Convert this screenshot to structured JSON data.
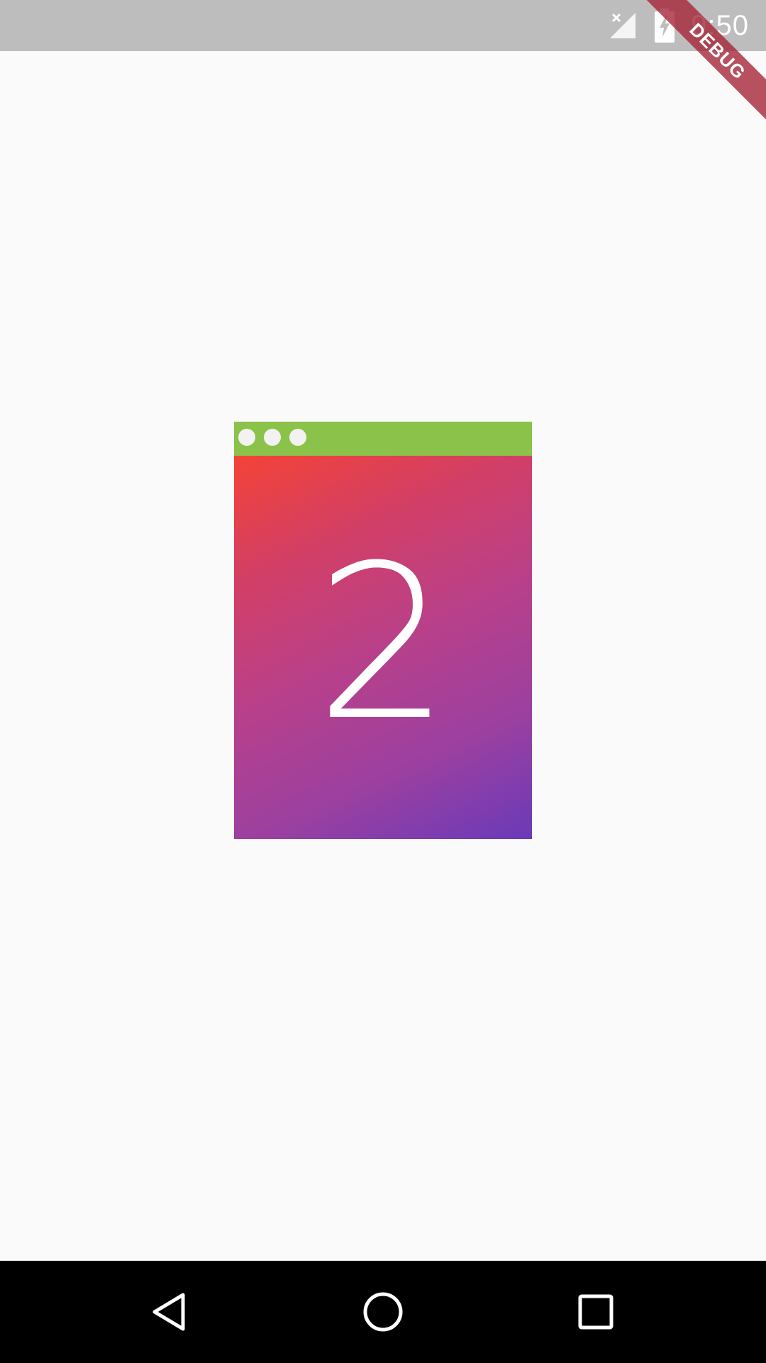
{
  "status_bar": {
    "time": "9:50",
    "icons": [
      "signal-off-icon",
      "battery-charging-icon"
    ],
    "background": "#bdbdbd"
  },
  "debug_banner": {
    "label": "DEBUG",
    "color": "#a42135"
  },
  "card": {
    "number": "2",
    "topbar_color": "#8bc34a",
    "gradient_colors": [
      "#f44336",
      "#6a3ab8"
    ],
    "dots": [
      "dot",
      "dot",
      "dot"
    ]
  },
  "nav_bar": {
    "buttons": [
      "back-icon",
      "home-icon",
      "recents-icon"
    ]
  }
}
